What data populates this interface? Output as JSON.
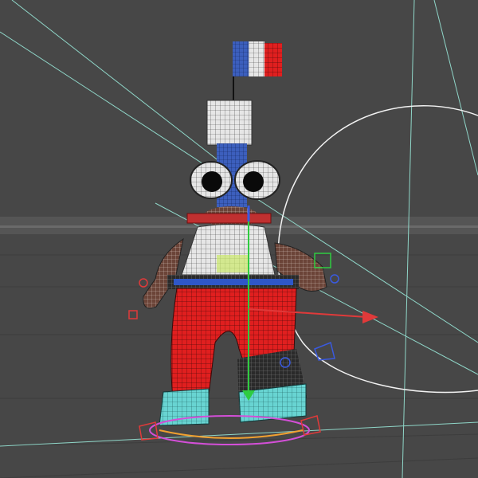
{
  "viewport": {
    "background": "#474747",
    "horizon_color": "#5a5a5a",
    "grid_color": "#3f3f3f",
    "guide_color": "#8fd6c8"
  },
  "character": {
    "flag_colors": [
      "#2b56c7",
      "#f2f2f2",
      "#e23a3a"
    ],
    "pants_color": "#e01f1f",
    "boots_color": "#5fcfd0",
    "shirt_color": "#8a5a4a",
    "head_color": "#d8d8d8",
    "neck_color": "#3c5fbd"
  },
  "gizmo": {
    "x_axis_color": "#e03a3a",
    "y_axis_color": "#2ecc40",
    "z_axis_color": "#3a5ae0",
    "rotation_ring_color": "#d44fd8"
  }
}
